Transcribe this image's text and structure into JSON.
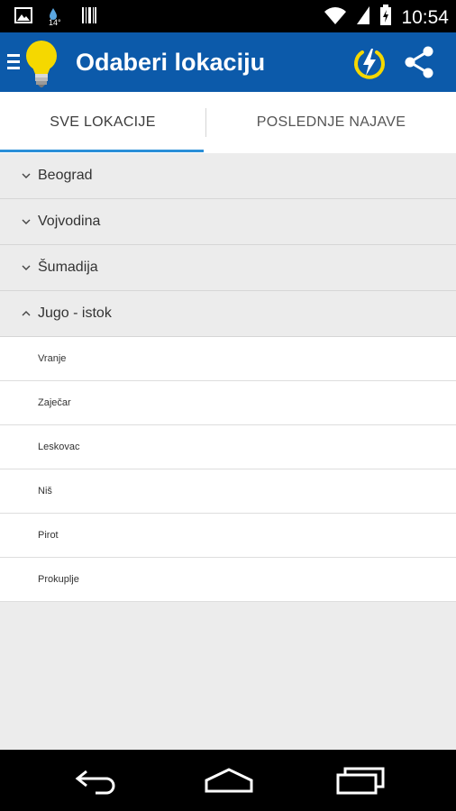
{
  "status_bar": {
    "time": "10:54",
    "weather_temp": "14°",
    "icons": [
      "image-icon",
      "weather-icon",
      "barcode-icon",
      "wifi-icon",
      "signal-icon",
      "battery-icon"
    ]
  },
  "app_bar": {
    "title": "Odaberi lokaciju",
    "icons": [
      "menu-icon",
      "lightbulb-icon",
      "power-icon",
      "share-icon"
    ],
    "colors": {
      "background": "#0c5aaa",
      "accent": "#f5d800"
    }
  },
  "tabs": [
    {
      "label": "SVE LOKACIJE",
      "selected": true
    },
    {
      "label": "POSLEDNJE NAJAVE",
      "selected": false
    }
  ],
  "groups": [
    {
      "label": "Beograd",
      "expanded": false
    },
    {
      "label": "Vojvodina",
      "expanded": false
    },
    {
      "label": "Šumadija",
      "expanded": false
    },
    {
      "label": "Jugo - istok",
      "expanded": true
    }
  ],
  "children": [
    {
      "label": "Vranje"
    },
    {
      "label": "Zaječar"
    },
    {
      "label": "Leskovac"
    },
    {
      "label": "Niš"
    },
    {
      "label": "Pirot"
    },
    {
      "label": "Prokuplje"
    }
  ],
  "nav_bar": [
    "back-icon",
    "home-icon",
    "recents-icon"
  ]
}
